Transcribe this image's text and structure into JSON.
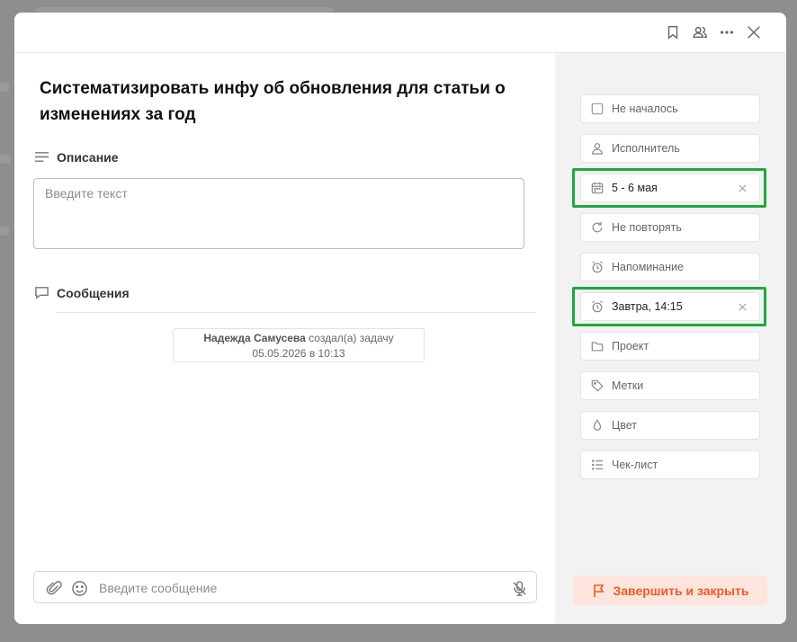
{
  "task": {
    "title": "Систематизировать инфу об обновления для статьи о изменениях за год"
  },
  "header": {
    "icons": [
      "bookmark-icon",
      "users-icon",
      "more-icon",
      "close-icon"
    ]
  },
  "description": {
    "label": "Описание",
    "placeholder": "Введите текст"
  },
  "messages": {
    "label": "Сообщения",
    "system_message": {
      "author": "Надежда Самусева",
      "action": "создал(а) задачу",
      "timestamp": "05.05.2026 в 10:13"
    }
  },
  "composer": {
    "placeholder": "Введите сообщение"
  },
  "properties": [
    {
      "key": "status",
      "label": "Не началось",
      "icon": "checkbox-icon",
      "filled": false
    },
    {
      "key": "assignee",
      "label": "Исполнитель",
      "icon": "user-icon",
      "filled": false
    },
    {
      "key": "dates",
      "label": "5 - 6 мая",
      "icon": "calendar-icon",
      "filled": true,
      "highlighted": true
    },
    {
      "key": "repeat",
      "label": "Не повторять",
      "icon": "repeat-icon",
      "filled": false
    },
    {
      "key": "reminder",
      "label": "Напоминание",
      "icon": "alarm-icon",
      "filled": false
    },
    {
      "key": "reminder-set",
      "label": "Завтра, 14:15",
      "icon": "alarm-icon",
      "filled": true,
      "highlighted": true
    },
    {
      "key": "project",
      "label": "Проект",
      "icon": "folder-icon",
      "filled": false
    },
    {
      "key": "tags",
      "label": "Метки",
      "icon": "tag-icon",
      "filled": false
    },
    {
      "key": "color",
      "label": "Цвет",
      "icon": "drop-icon",
      "filled": false
    },
    {
      "key": "checklist",
      "label": "Чек-лист",
      "icon": "checklist-icon",
      "filled": false
    }
  ],
  "actions": {
    "complete_label": "Завершить и закрыть"
  },
  "colors": {
    "accent": "#ef5a26",
    "highlight": "#1fa83b"
  }
}
